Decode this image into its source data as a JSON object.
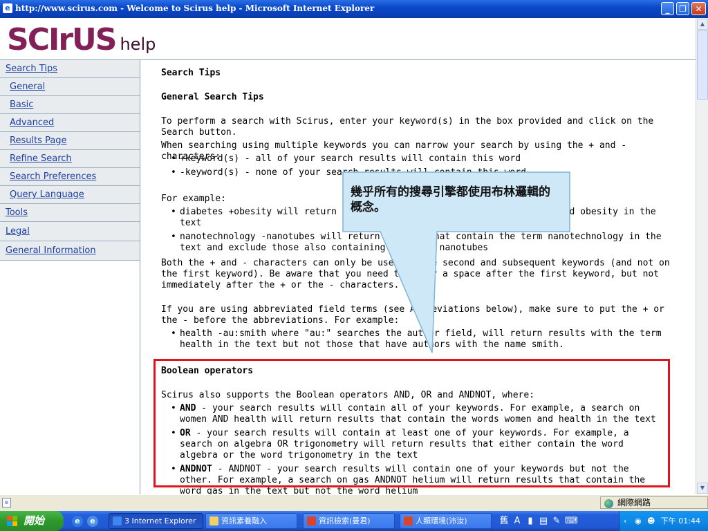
{
  "window": {
    "title": "http://www.scirus.com - Welcome to Scirus help - Microsoft Internet Explorer",
    "min_glyph": "_",
    "max_glyph": "❐",
    "close_glyph": "✕"
  },
  "logo": {
    "brand": "SCIrUS",
    "suffix": "help"
  },
  "sidebar": {
    "items": [
      {
        "label": "Search Tips"
      },
      {
        "label": "General"
      },
      {
        "label": "Basic"
      },
      {
        "label": "Advanced"
      },
      {
        "label": "Results Page"
      },
      {
        "label": "Refine Search"
      },
      {
        "label": "Search Preferences"
      },
      {
        "label": "Query Language"
      },
      {
        "label": "Tools"
      },
      {
        "label": "Legal"
      },
      {
        "label": "General Information"
      }
    ]
  },
  "main": {
    "h_search_tips": "Search Tips",
    "h_general": "General Search Tips",
    "p1": "To perform a search with Scirus, enter your keyword(s) in the box provided and click on the Search button.",
    "p2": "When searching using multiple keywords you can narrow your search by using the + and - characters:",
    "b1": "+keyword(s) - all of your search results will contain this word",
    "b2": "-keyword(s) - none of your search results will contain this word",
    "p3": "For example:",
    "b3": "diabetes +obesity will return results that contain the terms diabetes and obesity in the text",
    "b4": "nanotechnology -nanotubes will return results that contain the term nanotechnology in the text and exclude those also containing the term nanotubes",
    "p4": "Both the + and - characters can only be used on the second and subsequent keywords (and not on the first keyword). Be aware that you need to enter a space after the first keyword, but not immediately after the + or the - characters.",
    "p5": "If you are using abbreviated field terms (see Abbreviations below), make sure to put the + or the - before the abbreviations. For example:",
    "b5": "health -au:smith where \"au:\" searches the author field, will return results with the term health in the text but not those that have authors with the name smith.",
    "h_boolean": "Boolean operators",
    "p6": "Scirus also supports the Boolean operators AND, OR and ANDNOT, where:",
    "and_term": "AND",
    "and_text": " - your search results will contain all of your keywords. For example, a search on women AND health will return results that contain the words women and health in the text",
    "or_term": "OR",
    "or_text": " - your search results will contain at least one of your keywords. For example, a search on algebra OR trigonometry will return results that either contain the word algebra or the word trigonometry in the text",
    "andnot_term": "ANDNOT",
    "andnot_text": " - ANDNOT - your search results will contain one of your keywords but not the other. For example, a search on gas ANDNOT helium will return results that contain the word gas in the text but not the word helium"
  },
  "callout": {
    "text": "幾乎所有的搜尋引擎都使用布林邏輯的概念。"
  },
  "statusbar": {
    "zone": "網際網路"
  },
  "taskbar": {
    "start": "開始",
    "tasks": [
      {
        "label": "3 Internet Explorer"
      },
      {
        "label": "資訊素養融入"
      },
      {
        "label": "資訊檢索(曼君)"
      },
      {
        "label": "人類環境(沛汝)"
      }
    ],
    "ime": [
      "舊",
      "A"
    ],
    "clock": "下午 01:44"
  },
  "colors": {
    "brand": "#822158",
    "link": "#1c3fa3",
    "highlight": "#e0141e",
    "callout_fill": "#cfe8f7"
  }
}
